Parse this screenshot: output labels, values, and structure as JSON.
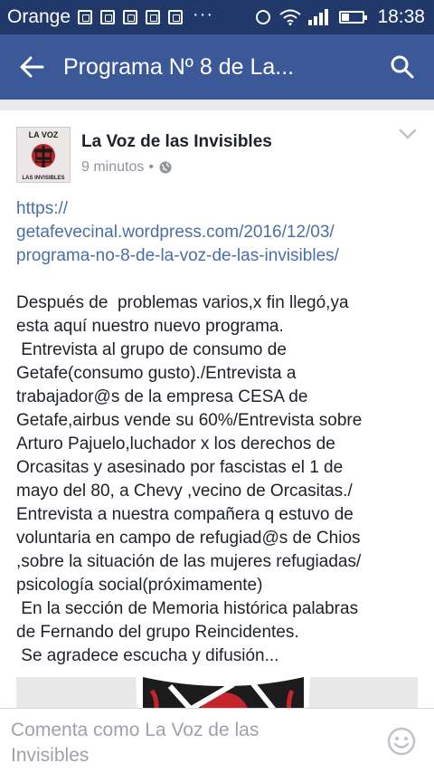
{
  "status_bar": {
    "carrier": "Orange",
    "dots": "···",
    "time": "18:38"
  },
  "app_bar": {
    "title": "Programa Nº 8 de La..."
  },
  "post": {
    "author": "La Voz de las Invisibles",
    "time": "9 minutos",
    "separator": "•",
    "avatar_text_top": "LA VOZ",
    "avatar_text_bottom": "LAS INVISIBLES",
    "link": "https://\ngetafevecinal.wordpress.com/2016/12/03/\nprograma-no-8-de-la-voz-de-las-invisibles/",
    "body": "Después de  problemas varios,x fin llegó,ya\nesta aquí nuestro nuevo programa.\n Entrevista al grupo de consumo de\nGetafe(consumo gusto)./Entrevista a\ntrabajador@s de la empresa CESA de\nGetafe,airbus vende su 60%/Entrevista sobre\nArturo Pajuelo,luchador x los derechos de\nOrcasitas y asesinado por fascistas el 1 de\nmayo del 80, a Chevy ,vecino de Orcasitas./\nEntrevista a nuestra compañera q estuvo de\nvoluntaria en campo de refugiad@s de Chios\n,sobre la situación de las mujeres refugiadas/\npsicología social(próximamente)\n En la sección de Memoria histórica palabras\nde Fernando del grupo Reincidentes.\n Se agradece escucha y difusión..."
  },
  "comment_bar": {
    "placeholder": "Comenta como La Voz de las\nInvisibles"
  },
  "colors": {
    "status_bar": "#21386b",
    "app_bar": "#3b5998",
    "link": "#4a6ea9",
    "text": "#1d2129",
    "muted": "#90949c"
  },
  "icons": [
    "image-notification-icon",
    "alarm-icon",
    "wifi-icon",
    "signal-icon",
    "battery-icon",
    "back-arrow-icon",
    "search-icon",
    "globe-icon",
    "chevron-down-icon",
    "emoji-icon"
  ]
}
